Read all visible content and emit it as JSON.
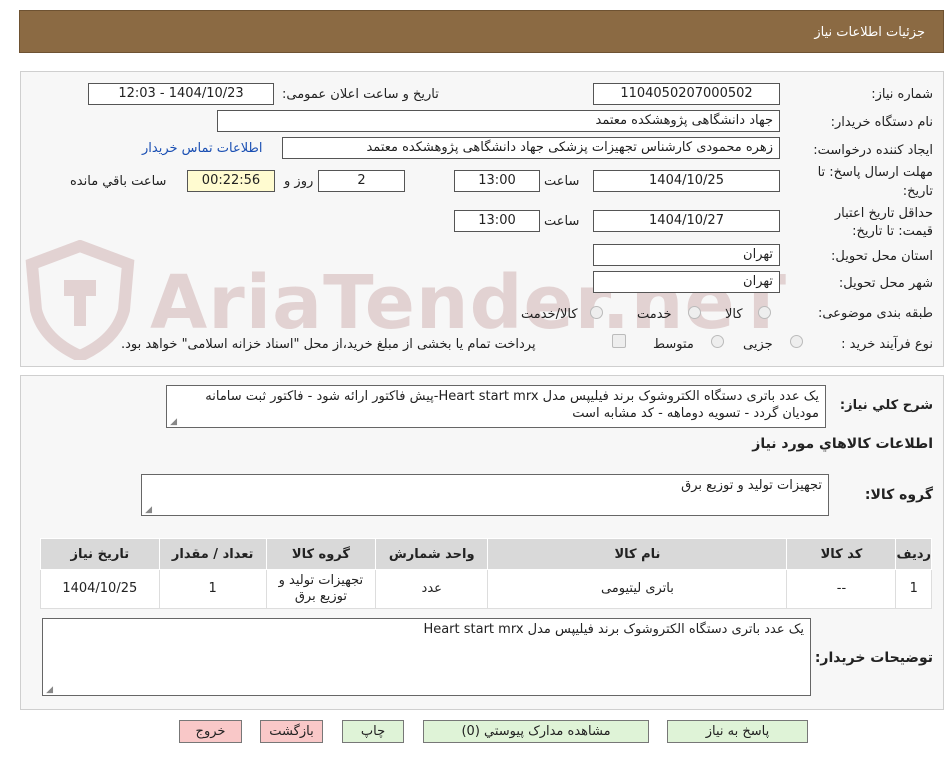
{
  "header": {
    "title": "جزئیات اطلاعات نیاز"
  },
  "form": {
    "need_number_label": "شماره نیاز:",
    "need_number": "1104050207000502",
    "announce_label": "تاریخ و ساعت اعلان عمومی:",
    "announce_value": "1404/10/23 - 12:03",
    "buyer_org_label": "نام دستگاه خریدار:",
    "buyer_org": "جهاد دانشگاهی پژوهشکده معتمد",
    "creator_label": "ایجاد کننده درخواست:",
    "creator": "زهره محمودی کارشناس تجهیزات پزشکی جهاد دانشگاهی پژوهشکده معتمد",
    "contact_link": "اطلاعات تماس خریدار",
    "deadline_label_1": "مهلت ارسال پاسخ: تا",
    "deadline_label_2": "تاریخ:",
    "deadline_date": "1404/10/25",
    "time_label": "ساعت",
    "deadline_time": "13:00",
    "days_value": "2",
    "days_label": "روز و",
    "remaining_time": "00:22:56",
    "remaining_label": "ساعت باقي مانده",
    "validity_label_1": "حداقل تاریخ اعتبار",
    "validity_label_2": "قیمت: تا تاریخ:",
    "validity_date": "1404/10/27",
    "validity_time_label": "ساعت",
    "validity_time": "13:00",
    "province_label": "استان محل تحویل:",
    "province": "تهران",
    "city_label": "شهر محل تحویل:",
    "city": "تهران",
    "category_label": "طبقه بندی موضوعی:",
    "category_options": [
      "کالا",
      "خدمت",
      "کالا/خدمت"
    ],
    "process_label": "نوع فرآیند خرید :",
    "process_options": [
      "جزیی",
      "متوسط"
    ],
    "payment_note": "پرداخت تمام یا بخشی از مبلغ خرید،از محل \"اسناد خزانه اسلامی\" خواهد بود."
  },
  "watermark": {
    "text": "AriaTender.neT"
  },
  "summary": {
    "label": "شرح کلي نياز:",
    "text": "یک عدد باتری دستگاه الکتروشوک برند فیلیپس مدل Heart start mrx-پیش فاکتور ارائه شود - فاکتور ثبت سامانه مودیان گردد - تسویه دوماهه - کد مشابه است"
  },
  "items_section": {
    "title": "اطلاعات کالاهاي مورد نياز",
    "group_label": "گروه کالا:",
    "group_value": "تجهیزات تولید و توزیع برق"
  },
  "table": {
    "headers": [
      "ردیف",
      "کد کالا",
      "نام کالا",
      "واحد شمارش",
      "گروه کالا",
      "تعداد / مقدار",
      "تاریخ نیاز"
    ],
    "rows": [
      [
        "1",
        "--",
        "باتری لیتیومی",
        "عدد",
        "تجهیزات تولید و توزیع برق",
        "1",
        "1404/10/25"
      ]
    ]
  },
  "buyer_notes": {
    "label": "توضیحات خریدار:",
    "text": "یک عدد باتری دستگاه الکتروشوک برند فیلیپس مدل Heart start mrx"
  },
  "buttons": {
    "reply": "پاسخ به نیاز",
    "attachments": "مشاهده مدارک پیوستي (0)",
    "print": "چاپ",
    "back": "بازگشت",
    "exit": "خروج"
  }
}
